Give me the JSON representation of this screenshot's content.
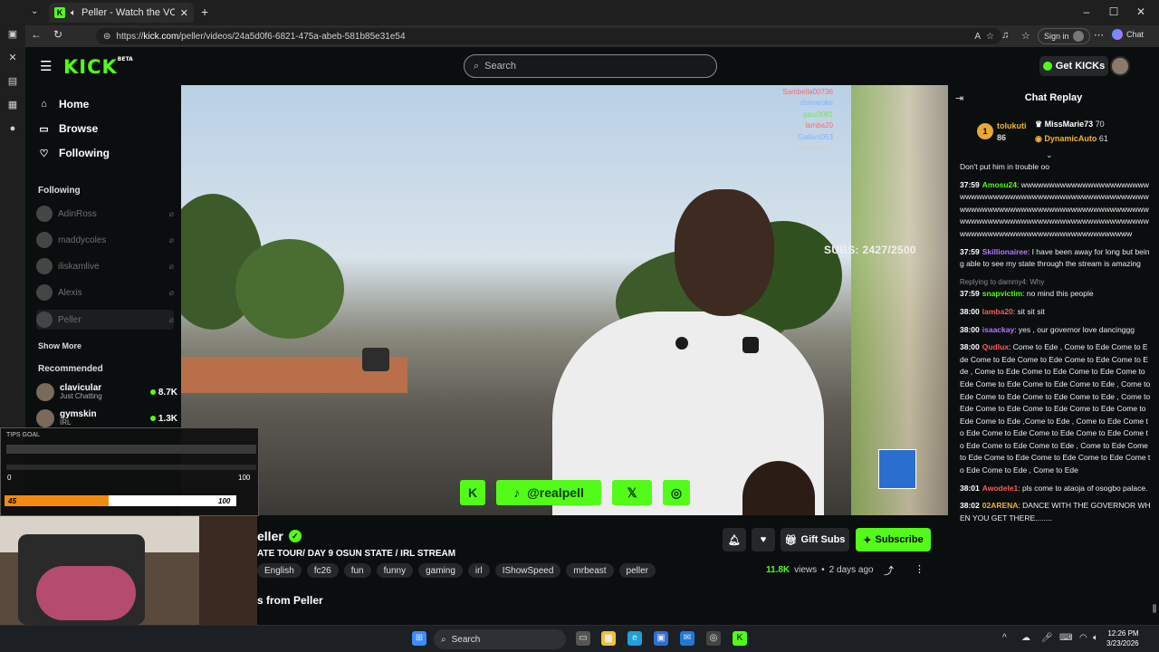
{
  "browser": {
    "tab_title": "Peller - Watch the VOD on Kick",
    "url_prefix": "https://",
    "url_host": "kick.com",
    "url_path": "/peller/videos/24a5d0f6-6821-475a-abeb-581b85e31e54",
    "sign_in": "Sign in",
    "copilot_label": "Chat"
  },
  "header": {
    "logo": "KICK",
    "logo_badge": "BETA",
    "search_placeholder": "Search",
    "get_kicks": "Get KICKs"
  },
  "sidebar": {
    "nav": [
      {
        "label": "Home",
        "icon": "home-icon"
      },
      {
        "label": "Browse",
        "icon": "browse-icon"
      },
      {
        "label": "Following",
        "icon": "heart-icon"
      }
    ],
    "following_title": "Following",
    "following": [
      "AdinRoss",
      "maddycoles",
      "iliskamlive",
      "Alexis",
      "Peller"
    ],
    "show_more": "Show More",
    "recommended_title": "Recommended",
    "recommended": [
      {
        "name": "clavicular",
        "category": "Just Chatting",
        "viewers": "8.7K"
      },
      {
        "name": "gymskin",
        "category": "IRL",
        "viewers": "1.3K"
      }
    ]
  },
  "video": {
    "subs_overlay": "SUBS: 2427/2500",
    "overlay_chat_names": [
      {
        "name": "Sambella00736",
        "color": "#ff6b6b"
      },
      {
        "name": "chimaroke",
        "color": "#7fb5ff"
      },
      {
        "name": "paul3081",
        "color": "#7dde6a"
      },
      {
        "name": "lamba20",
        "color": "#ff6b6b"
      },
      {
        "name": "Gallant053",
        "color": "#7fb5ff"
      },
      {
        "name": "Famsboy1",
        "color": "#cfcfcf"
      }
    ],
    "social_handle": "@realpell"
  },
  "channel": {
    "name": "eller",
    "title": "ATE TOUR/ DAY 9 OSUN STATE / IRL STREAM",
    "tags": [
      "English",
      "fc26",
      "fun",
      "funny",
      "gaming",
      "irl",
      "IShowSpeed",
      "mrbeast",
      "peller"
    ],
    "gift_subs": "Gift Subs",
    "subscribe": "Subscribe",
    "views": "11.8K",
    "views_label": "views",
    "age": "2 days ago",
    "more_videos": "s from Peller"
  },
  "chat": {
    "title": "Chat Replay",
    "leaderboard": [
      {
        "rank": "1",
        "name": "tolukuti",
        "count": "86"
      },
      {
        "name": "MissMarie73",
        "count": "70"
      },
      {
        "name": "DynamicAuto",
        "count": "61"
      }
    ],
    "messages": [
      {
        "ts": "",
        "user": "",
        "text": "Don't put him in trouble oo"
      },
      {
        "ts": "37:59",
        "user": "Amosu24",
        "text": ": wwwwwwwwwwwwwwwwwwwwwwwwwwwwwwwwwwwwwwwwwwwwwwwwwwwwwwwwwwwwwwwwwwwwwwwwwwwwwwwwwwwwwwwwwwwwwwwwwwwwwwwwwwwwwwwwwwwwwwwwwwwwwwwwwwwwwwwwwwwwwwwwwwwwwwwwwwww"
      },
      {
        "ts": "37:59",
        "user": "Skillionairee",
        "text": ": I have been away for long but being able to see my state through the stream is amazing"
      },
      {
        "reply": "Replying to dammy4: Why",
        "ts": "37:59",
        "user": "snapvictim",
        "text": ": no mind this people"
      },
      {
        "ts": "38:00",
        "user": "lamba20",
        "text": ": sit sit sit"
      },
      {
        "ts": "38:00",
        "user": "isaackay",
        "text": ": yes , our governor love dancinggg"
      },
      {
        "ts": "38:00",
        "user": "Qudlux",
        "text": ": Come to Ede , Come to Ede Come to Ede Come to Ede Come to Ede Come to Ede Come to Ede , Come to Ede Come to Ede Come to Ede Come to Ede Come to Ede Come to Ede Come to Ede , Come to Ede Come to Ede Come to Ede Come to Ede , Come to Ede Come to Ede Come to Ede Come to Ede Come to Ede Come to Ede ,Come to Ede , Come to Ede Come to Ede Come to Ede Come to Ede Come to Ede Come to Ede Come to Ede Come to Ede , Come to Ede Come to Ede Come to Ede Come to Ede Come to Ede Come to Ede Come to Ede , Come to Ede"
      },
      {
        "ts": "38:01",
        "user": "Awodele1",
        "text": ": pls come to ataoja of osogbo palace."
      },
      {
        "ts": "38:02",
        "user": "02ARENA",
        "text": ": DANCE WITH THE GOVERNOR WHEN YOU GET THERE........"
      }
    ]
  },
  "tips_goal": {
    "title": "TIPS GOAL",
    "min": "0",
    "max_top": "100",
    "current": "45",
    "max": "100",
    "progress": 0.45
  },
  "taskbar": {
    "search": "Search",
    "time": "12:26 PM",
    "date": "3/23/2026"
  }
}
